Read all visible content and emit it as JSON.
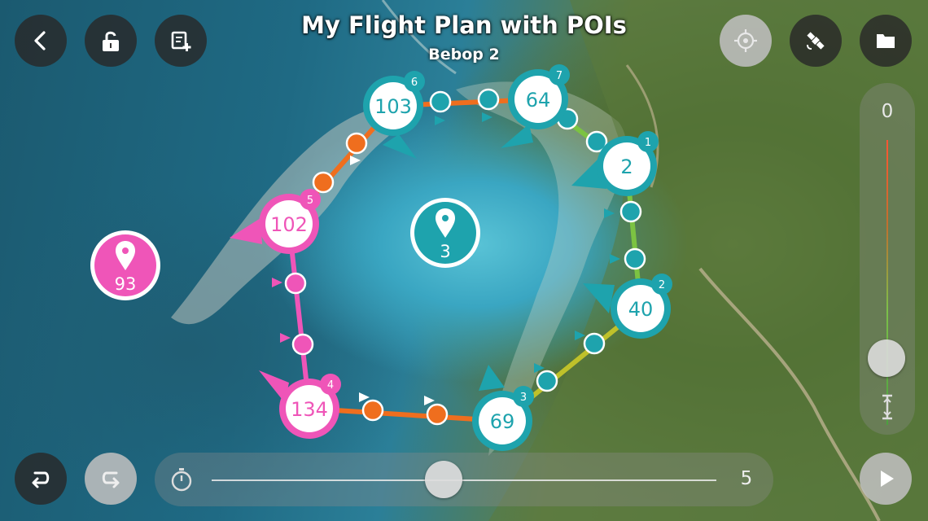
{
  "header": {
    "title": "My Flight Plan with POIs",
    "subtitle": "Bebop 2"
  },
  "toolbar_left": [
    {
      "icon": "back-arrow-icon"
    },
    {
      "icon": "unlock-icon"
    },
    {
      "icon": "edit-plan-icon"
    }
  ],
  "toolbar_right": [
    {
      "icon": "target-icon"
    },
    {
      "icon": "satellite-icon"
    },
    {
      "icon": "folder-icon"
    }
  ],
  "altitude": {
    "value": "0"
  },
  "speed": {
    "value": "5",
    "slider_fraction": 0.46
  },
  "bottom_left": [
    {
      "icon": "undo-icon"
    },
    {
      "icon": "redo-icon"
    }
  ],
  "play": {
    "icon": "play-icon"
  },
  "colors": {
    "teal": "#1ea3ad",
    "pink": "#ef55b8",
    "orange": "#ef6e1e",
    "green": "#7cc342",
    "olive": "#bfc12a"
  },
  "waypoints": [
    {
      "index": "1",
      "altitude": "2"
    },
    {
      "index": "2",
      "altitude": "40"
    },
    {
      "index": "3",
      "altitude": "69"
    },
    {
      "index": "4",
      "altitude": "134"
    },
    {
      "index": "5",
      "altitude": "102"
    },
    {
      "index": "6",
      "altitude": "103"
    },
    {
      "index": "7",
      "altitude": "64"
    }
  ],
  "pois": [
    {
      "label": "3"
    },
    {
      "label": "93"
    }
  ]
}
